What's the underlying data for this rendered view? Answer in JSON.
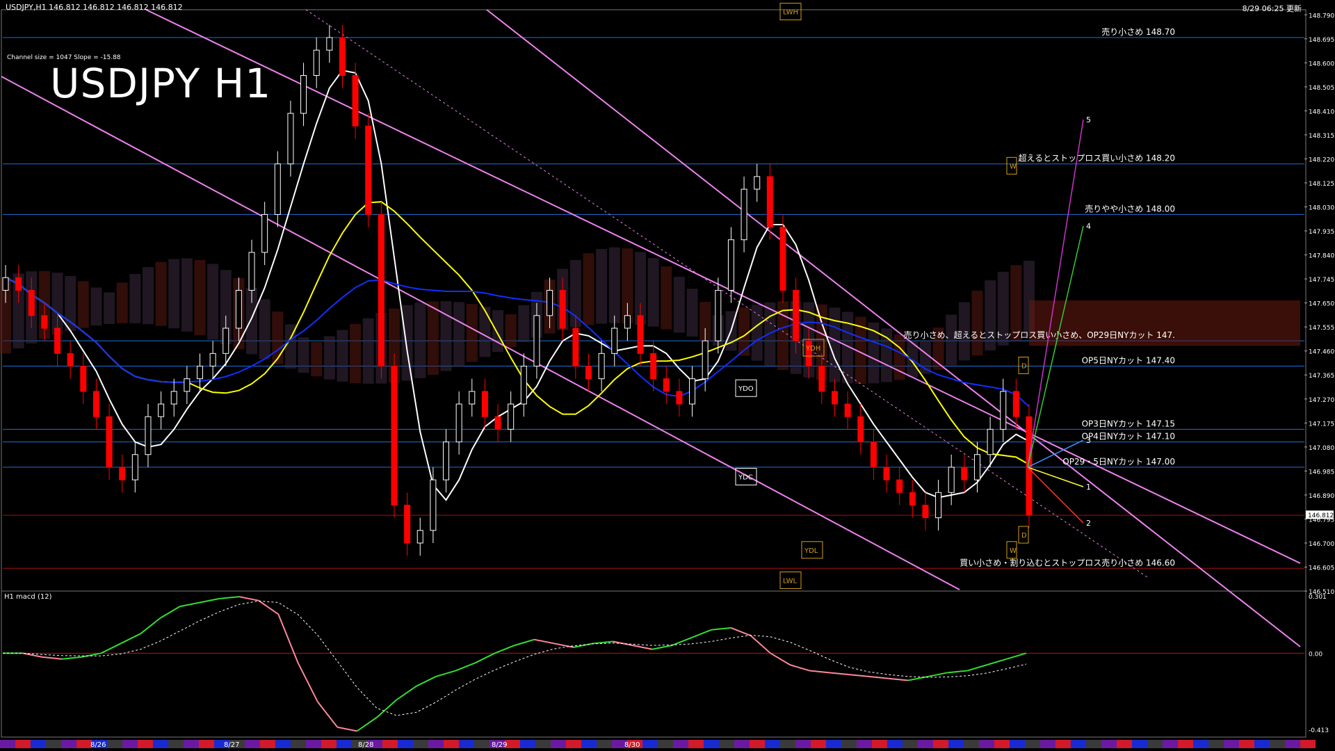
{
  "header": {
    "symbol_info": "USDJPY,H1  146.812 146.812 146.812 146.812",
    "timestamp": "8/29 06:25 更新",
    "channel_info": "Channel size = 1047 Slope = -15.88",
    "title": "USDJPY H1"
  },
  "macd_panel": {
    "label": "H1  macd (12)",
    "axis": [
      "0.301",
      "0.00",
      "-0.413"
    ]
  },
  "date_labels": [
    "8/26",
    "8/27",
    "8/28",
    "8/29",
    "8/30"
  ],
  "colors": {
    "background": "#000000",
    "bull_candle": "#ffffff",
    "bear_candle": "#ff0000",
    "level_line": "#1e6fd9",
    "channel_line": "#ee82ee",
    "ma_white": "#ffffff",
    "ma_yellow": "#ffff00",
    "ma_blue": "#1030ff",
    "macd_up": "#33dd33",
    "macd_down": "#ff8899",
    "macd_signal": "#ffffff"
  },
  "price_axis": [
    "148.790",
    "148.695",
    "148.600",
    "148.505",
    "148.410",
    "148.315",
    "148.220",
    "148.125",
    "148.030",
    "147.935",
    "147.840",
    "147.745",
    "147.650",
    "147.555",
    "147.460",
    "147.365",
    "147.270",
    "147.175",
    "147.080",
    "146.985",
    "146.890",
    "146.795",
    "146.700",
    "146.605",
    "146.510"
  ],
  "current_price_tag": "146.812",
  "level_labels": [
    {
      "text": "売り小さめ 148.70",
      "price": 148.7
    },
    {
      "text": "超えるとストップロス買い小さめ 148.20",
      "price": 148.2
    },
    {
      "text": "売りやや小さめ 148.00",
      "price": 148.0
    },
    {
      "text": "売り小さめ、超えるとストップロス買い小さめ、OP29日NYカット 147.",
      "price": 147.5
    },
    {
      "text": "OP5日NYカット 147.40",
      "price": 147.4
    },
    {
      "text": "OP3日NYカット 147.15",
      "price": 147.15
    },
    {
      "text": "OP4日NYカット 147.10",
      "price": 147.1
    },
    {
      "text": "OP29・5日NYカット 147.00",
      "price": 147.0
    },
    {
      "text": "買い小さめ・割り込むとストップロス売り小さめ 146.60",
      "price": 146.6
    }
  ],
  "box_labels": [
    "LWH",
    "YDH",
    "YDO",
    "YDC",
    "YDL",
    "LWL",
    "W",
    "W",
    "D",
    "D"
  ],
  "projection_labels": [
    "5",
    "4",
    "3",
    "1",
    "2"
  ],
  "chart_data": {
    "type": "candlestick",
    "title": "USDJPY H1",
    "ylim": [
      146.51,
      148.81
    ],
    "x_dates": [
      "8/26",
      "8/27",
      "8/28",
      "8/29",
      "8/30"
    ],
    "horizontal_levels": [
      148.7,
      148.2,
      148.0,
      147.5,
      147.4,
      147.15,
      147.1,
      147.0,
      146.81,
      146.6
    ],
    "candles_close": [
      147.75,
      147.7,
      147.6,
      147.55,
      147.45,
      147.4,
      147.3,
      147.2,
      147.0,
      146.95,
      147.05,
      147.2,
      147.25,
      147.3,
      147.35,
      147.4,
      147.45,
      147.55,
      147.7,
      147.85,
      148.0,
      148.2,
      148.4,
      148.55,
      148.65,
      148.7,
      148.55,
      148.35,
      148.0,
      147.4,
      146.85,
      146.7,
      146.75,
      146.95,
      147.1,
      147.25,
      147.3,
      147.2,
      147.15,
      147.25,
      147.4,
      147.6,
      147.7,
      147.55,
      147.4,
      147.35,
      147.45,
      147.55,
      147.6,
      147.45,
      147.35,
      147.3,
      147.25,
      147.35,
      147.5,
      147.7,
      147.9,
      148.1,
      148.15,
      147.95,
      147.7,
      147.5,
      147.4,
      147.3,
      147.25,
      147.2,
      147.1,
      147.0,
      146.95,
      146.9,
      146.85,
      146.8,
      146.9,
      147.0,
      146.95,
      147.05,
      147.15,
      147.3,
      147.2,
      146.81
    ],
    "macd_range": [
      -0.413,
      0.301
    ],
    "macd": [
      0.0,
      0.0,
      -0.02,
      -0.03,
      -0.02,
      0.0,
      0.05,
      0.1,
      0.18,
      0.24,
      0.26,
      0.28,
      0.29,
      0.27,
      0.2,
      -0.05,
      -0.25,
      -0.38,
      -0.4,
      -0.33,
      -0.24,
      -0.17,
      -0.12,
      -0.09,
      -0.05,
      0.0,
      0.04,
      0.07,
      0.05,
      0.03,
      0.05,
      0.06,
      0.04,
      0.02,
      0.04,
      0.08,
      0.12,
      0.13,
      0.09,
      0.0,
      -0.06,
      -0.09,
      -0.1,
      -0.11,
      -0.12,
      -0.13,
      -0.14,
      -0.12,
      -0.1,
      -0.09,
      -0.06,
      -0.03,
      0.0
    ]
  }
}
